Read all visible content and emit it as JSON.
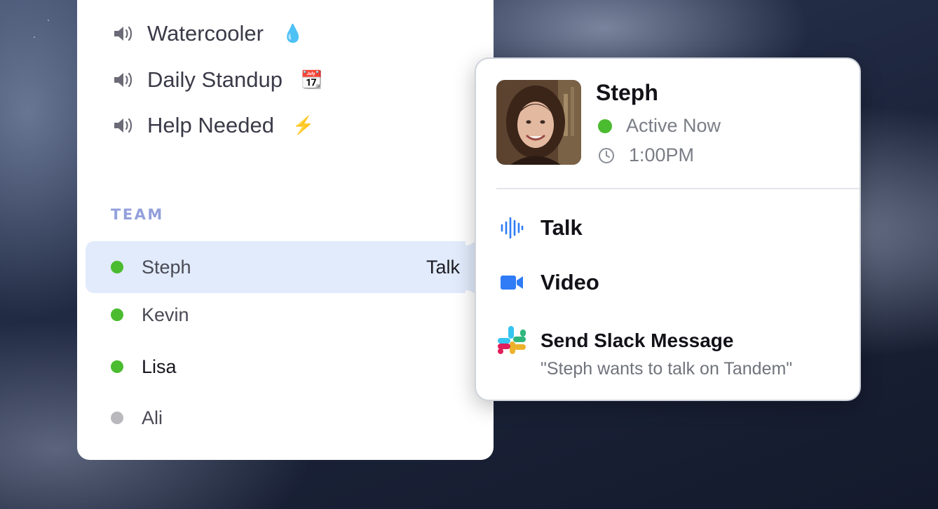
{
  "rooms": [
    {
      "label": "Watercooler",
      "emoji": "💧",
      "icon": "speaker-icon"
    },
    {
      "label": "Daily Standup",
      "emoji": "📆",
      "icon": "speaker-icon"
    },
    {
      "label": "Help Needed",
      "emoji": "⚡",
      "icon": "speaker-icon"
    }
  ],
  "team": {
    "title": "TEAM",
    "members": [
      {
        "name": "Steph",
        "status": "active",
        "status_color": "#4bbb2f",
        "action_label": "Talk"
      },
      {
        "name": "Kevin",
        "status": "active",
        "status_color": "#4bbb2f"
      },
      {
        "name": "Lisa",
        "status": "active",
        "status_color": "#4bbb2f"
      },
      {
        "name": "Ali",
        "status": "away",
        "status_color": "#b9b9bd"
      }
    ]
  },
  "popover": {
    "name": "Steph",
    "status_text": "Active Now",
    "local_time": "1:00PM",
    "actions": [
      {
        "label": "Talk",
        "icon": "waveform-icon",
        "color": "#2f7cf6"
      },
      {
        "label": "Video",
        "icon": "video-camera-icon",
        "color": "#2f7cf6"
      }
    ],
    "slack": {
      "title": "Send Slack Message",
      "message": "\"Steph wants to talk on Tandem\"",
      "icon": "slack-icon"
    }
  },
  "colors": {
    "accent": "#2f7cf6",
    "active": "#4bbb2f",
    "selected_row": "#e1ebfb",
    "section_title": "#93a0dc"
  }
}
